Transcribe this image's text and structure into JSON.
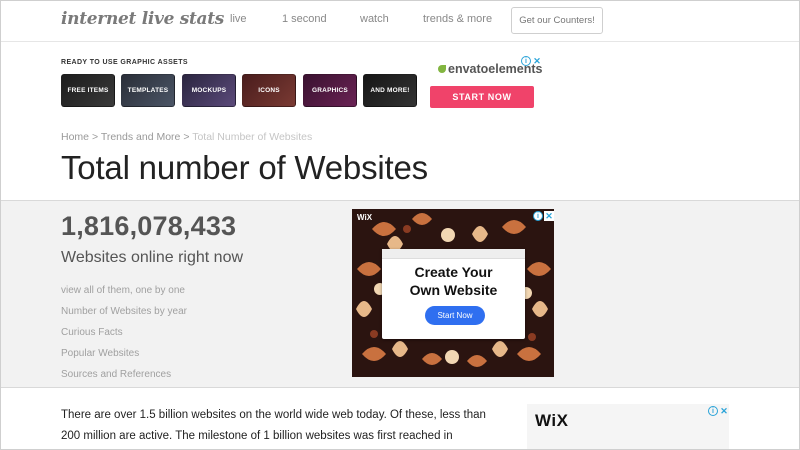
{
  "header": {
    "logo": "internet live stats",
    "nav": [
      "live",
      "1 second",
      "watch",
      "trends & more"
    ],
    "cta": "Get our Counters!"
  },
  "ad_top": {
    "ready_text": "READY TO USE GRAPHIC ASSETS",
    "tiles": [
      "FREE ITEMS",
      "TEMPLATES",
      "MOCKUPS",
      "ICONS",
      "GRAPHICS",
      "AND MORE!"
    ],
    "brand": "envatoelements",
    "cta": "START NOW"
  },
  "breadcrumb": {
    "home": "Home",
    "sep": ">",
    "section": "Trends and More",
    "current": "Total Number of Websites"
  },
  "page_title": "Total number of Websites",
  "stats": {
    "count": "1,816,078,433",
    "subtitle": "Websites online right now",
    "links": [
      "view all of them, one by one",
      "Number of Websites by year",
      "Curious Facts",
      "Popular Websites",
      "Sources and References"
    ]
  },
  "wix_ad": {
    "brand": "WiX",
    "headline_line1": "Create Your",
    "headline_line2": "Own Website",
    "cta": "Start Now"
  },
  "body": {
    "paragraph": "There are over 1.5 billion websites on the world wide web today. Of these, less than 200 million are active. The milestone of 1 billion websites was first reached in"
  },
  "wix_ad2": {
    "brand": "WiX"
  },
  "colors": {
    "accent_pink": "#f0436a",
    "envato_green": "#82b540",
    "wix_blue": "#2f6ff0",
    "band_grey": "#f2f2f2"
  }
}
